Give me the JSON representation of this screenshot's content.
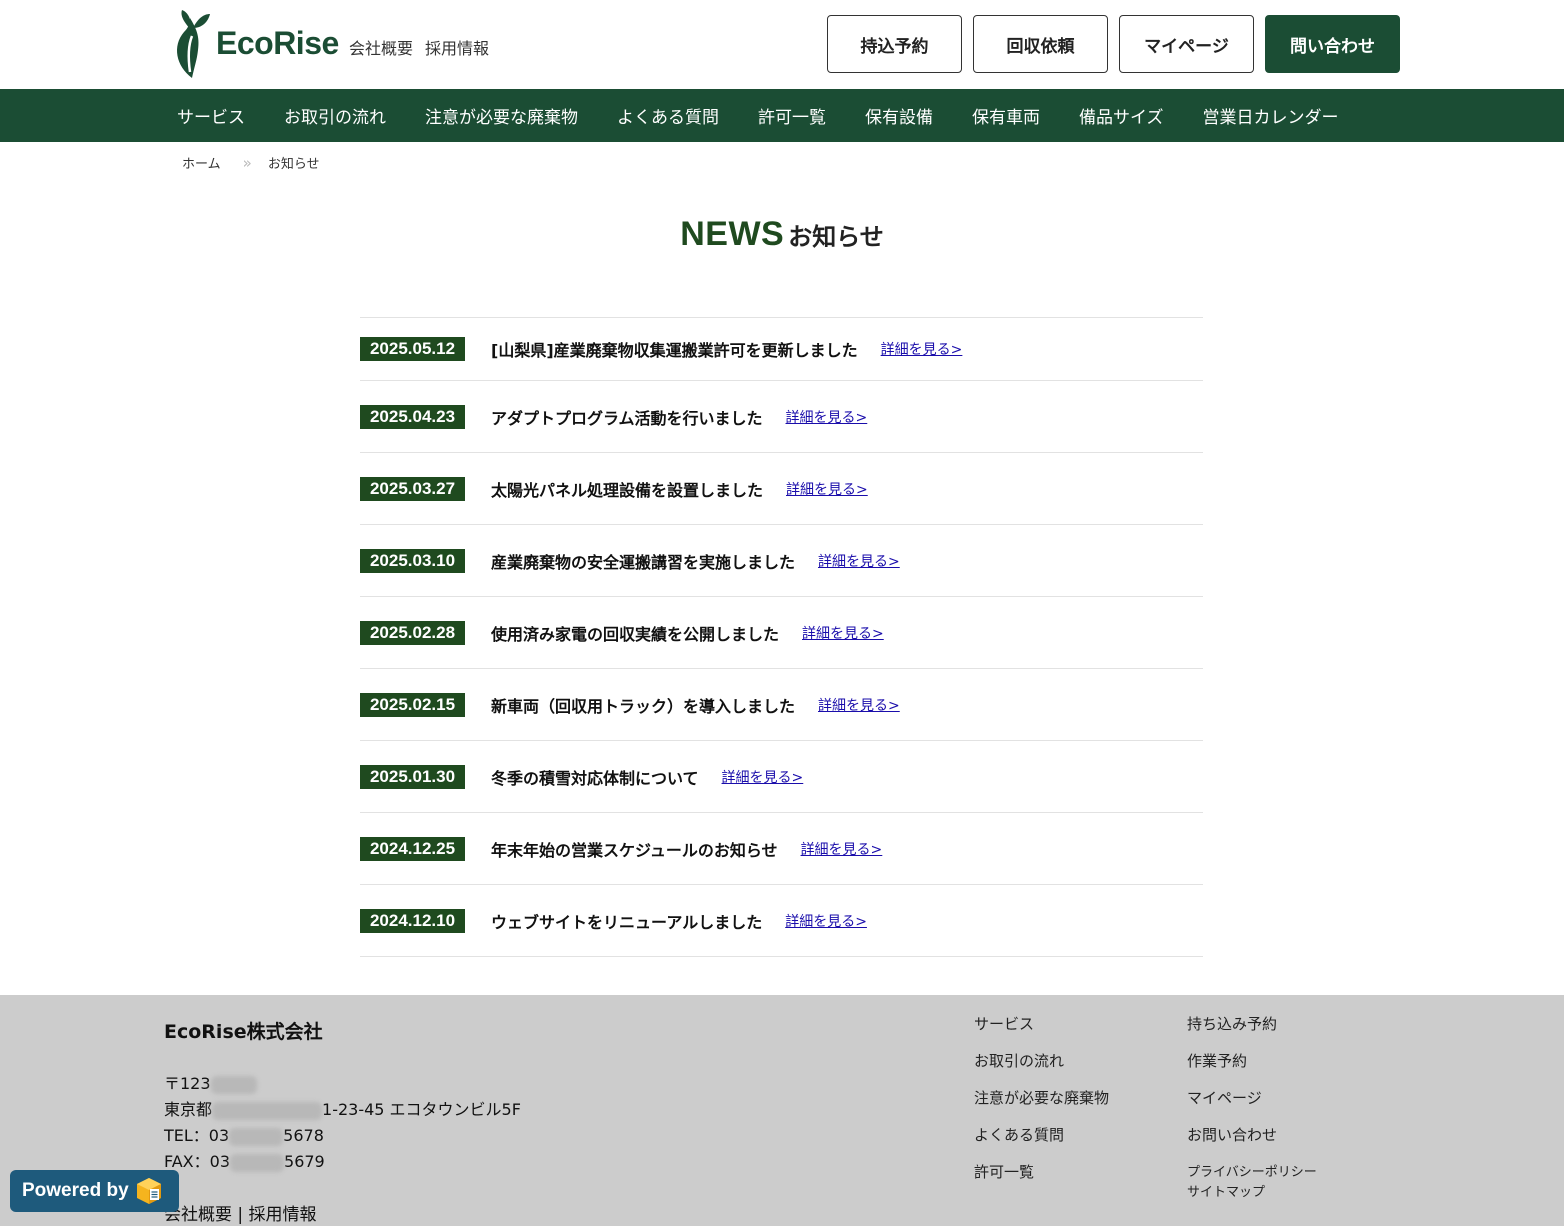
{
  "header": {
    "logo_text": "EcoRise",
    "links": [
      "会社概要",
      "採用情報"
    ],
    "buttons": [
      "持込予約",
      "回収依頼",
      "マイページ",
      "問い合わせ"
    ]
  },
  "nav": [
    "サービス",
    "お取引の流れ",
    "注意が必要な廃棄物",
    "よくある質問",
    "許可一覧",
    "保有設備",
    "保有車両",
    "備品サイズ",
    "営業日カレンダー"
  ],
  "breadcrumb": {
    "home": "ホーム",
    "separator": "»",
    "current": "お知らせ"
  },
  "title": {
    "en": "NEWS",
    "ja": "お知らせ"
  },
  "news": [
    {
      "date": "2025.05.12",
      "title": "[山梨県]産業廃棄物収集運搬業許可を更新しました",
      "link": "詳細を見る>"
    },
    {
      "date": "2025.04.23",
      "title": "アダプトプログラム活動を行いました",
      "link": "詳細を見る>"
    },
    {
      "date": "2025.03.27",
      "title": "太陽光パネル処理設備を設置しました",
      "link": "詳細を見る>"
    },
    {
      "date": "2025.03.10",
      "title": "産業廃棄物の安全運搬講習を実施しました",
      "link": "詳細を見る>"
    },
    {
      "date": "2025.02.28",
      "title": "使用済み家電の回収実績を公開しました",
      "link": "詳細を見る>"
    },
    {
      "date": "2025.02.15",
      "title": "新車両（回収用トラック）を導入しました",
      "link": "詳細を見る>"
    },
    {
      "date": "2025.01.30",
      "title": "冬季の積雪対応体制について",
      "link": "詳細を見る>"
    },
    {
      "date": "2024.12.25",
      "title": "年末年始の営業スケジュールのお知らせ",
      "link": "詳細を見る>"
    },
    {
      "date": "2024.12.10",
      "title": "ウェブサイトをリニューアルしました",
      "link": "詳細を見る>"
    }
  ],
  "footer": {
    "company": "EcoRise株式会社",
    "postal_prefix": "〒123",
    "address_prefix": "東京都",
    "address_suffix": "1-23-45 エコタウンビル5F",
    "tel_prefix": "TEL：03",
    "tel_suffix": "5678",
    "fax_prefix": "FAX：03",
    "fax_suffix": "5679",
    "bottom_links": "会社概要 | 採用情報",
    "col1": [
      "サービス",
      "お取引の流れ",
      "注意が必要な廃棄物",
      "よくある質問",
      "許可一覧"
    ],
    "col2": [
      "持ち込み予約",
      "作業予約",
      "マイページ",
      "お問い合わせ"
    ],
    "col2_small": [
      "プライバシーポリシー",
      "サイトマップ"
    ]
  },
  "powered": {
    "label": "Powered by",
    "icon": "cube-logo-icon"
  },
  "colors": {
    "brand_green": "#1b4d34",
    "date_badge": "#1f4a1f",
    "footer_bg": "#cccccc",
    "link": "#1a0dab",
    "badge_blue": "#1e5a7c"
  }
}
